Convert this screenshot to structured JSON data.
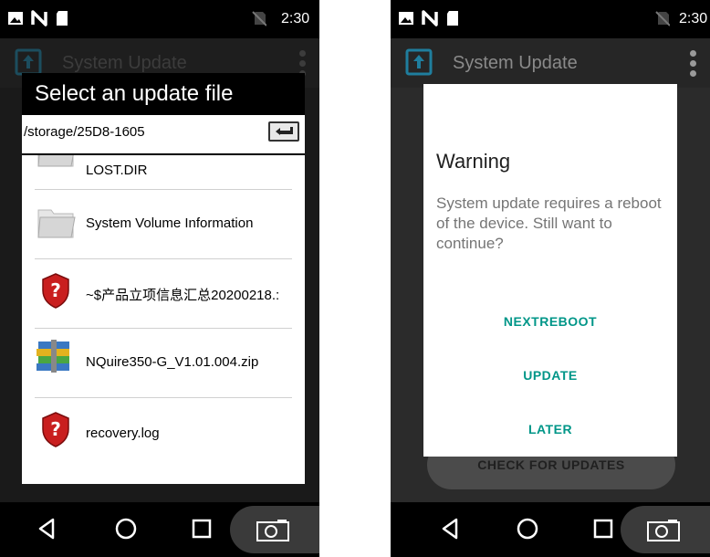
{
  "colors": {
    "accent": "#009688",
    "app_title_dim": "#4a4a4a",
    "app_title": "#bdbdbd",
    "check_btn_bg": "#4b4b4b",
    "check_btn_text": "#202020",
    "camera_btn_bg": "#3a3a3a"
  },
  "left": {
    "status_bar": {
      "time": "2:30",
      "icons": [
        "image-icon",
        "nfc-icon",
        "sd-card-icon",
        "no-sim-icon"
      ]
    },
    "app_bar": {
      "title": "System Update",
      "icon": "system-update-icon"
    },
    "picker": {
      "title": "Select an update file",
      "path": "/storage/25D8-1605",
      "back_icon": "back-arrow-icon",
      "files": [
        {
          "name": "LOST.DIR",
          "icon": "folder-icon"
        },
        {
          "name": "System Volume Information",
          "icon": "folder-icon"
        },
        {
          "name": "~$产品立项信息汇总20200218.:",
          "icon": "shield-icon"
        },
        {
          "name": "NQuire350-G_V1.01.004.zip",
          "icon": "archive-icon"
        },
        {
          "name": "recovery.log",
          "icon": "shield-icon"
        }
      ]
    },
    "nav": [
      "back-icon",
      "home-icon",
      "recents-icon",
      "camera-icon"
    ]
  },
  "right": {
    "status_bar": {
      "time": "2:30",
      "icons": [
        "image-icon",
        "nfc-icon",
        "sd-card-icon",
        "no-sim-icon"
      ]
    },
    "app_bar": {
      "title": "System Update",
      "icon": "system-update-icon"
    },
    "check_button": "CHECK FOR UPDATES",
    "dialog": {
      "title": "Warning",
      "message": "System update requires a reboot of the device. Still want to continue?",
      "buttons": [
        "NEXTREBOOT",
        "UPDATE",
        "LATER"
      ]
    },
    "nav": [
      "back-icon",
      "home-icon",
      "recents-icon",
      "camera-icon"
    ]
  }
}
